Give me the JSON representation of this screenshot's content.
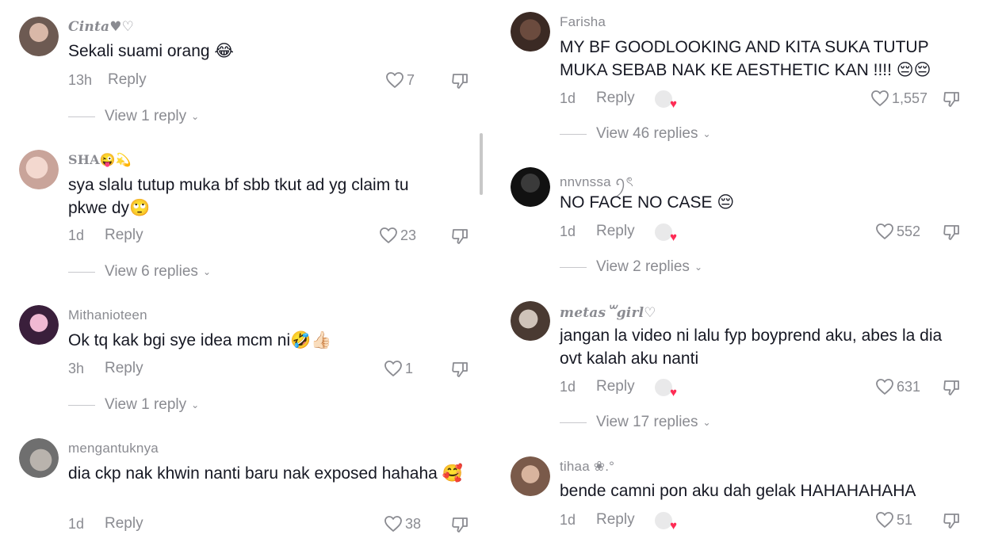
{
  "left": [
    {
      "username": "Cinta♥♡",
      "text": "Sekali suami orang 😂",
      "time": "13h",
      "reply": "Reply",
      "likes": "7",
      "view": "View 1 reply",
      "avatar_color": "#6d5a52"
    },
    {
      "username": "SHA😜💫",
      "text": "sya slalu tutup muka bf sbb tkut ad yg claim tu pkwe dy🙄",
      "time": "1d",
      "reply": "Reply",
      "likes": "23",
      "view": "View 6 replies",
      "avatar_color": "#e8c6bd"
    },
    {
      "username": "Mithanioteen",
      "text": "Ok tq kak bgi sye idea mcm ni🤣👍🏻",
      "time": "3h",
      "reply": "Reply",
      "likes": "1",
      "view": "View 1 reply",
      "avatar_color": "#3a1f3b"
    },
    {
      "username": "mengantuknya",
      "text": "dia ckp nak khwin nanti baru nak exposed hahaha 🥰",
      "time": "1d",
      "reply": "Reply",
      "likes": "38",
      "view": "",
      "avatar_color": "#8f8f8f"
    }
  ],
  "right": [
    {
      "username": "Farisha",
      "text": "MY BF GOODLOOKING AND KITA SUKA TUTUP MUKA SEBAB NAK KE AESTHETIC KAN !!!! 😔😔",
      "time": "1d",
      "reply": "Reply",
      "likes": "1,557",
      "view": "View 46 replies",
      "avatar_color": "#3b2a24"
    },
    {
      "username": "nnvnssa ꪆৎ",
      "text": "NO FACE NO CASE 😔",
      "time": "1d",
      "reply": "Reply",
      "likes": "552",
      "view": "View 2 replies",
      "avatar_color": "#1c1c1c"
    },
    {
      "username": "metas꒳girl♡",
      "text": "jangan la video ni lalu fyp boyprend aku, abes la dia ovt kalah aku nanti",
      "time": "1d",
      "reply": "Reply",
      "likes": "631",
      "view": "View 17 replies",
      "avatar_color": "#4a3a32"
    },
    {
      "username": "tihaa ❀.°",
      "text": "bende camni pon aku dah gelak HAHAHAHAHA",
      "time": "1d",
      "reply": "Reply",
      "likes": "51",
      "view": "",
      "avatar_color": "#7a5a4a"
    }
  ],
  "icons": {
    "like": "heart-outline-icon",
    "dislike": "thumbs-down-icon",
    "creator_liked": "creator-liked-avatar-icon",
    "chevron": "chevron-down-icon"
  },
  "colors": {
    "text": "#161823",
    "muted": "#8a8b91",
    "heart": "#fe2c55"
  }
}
